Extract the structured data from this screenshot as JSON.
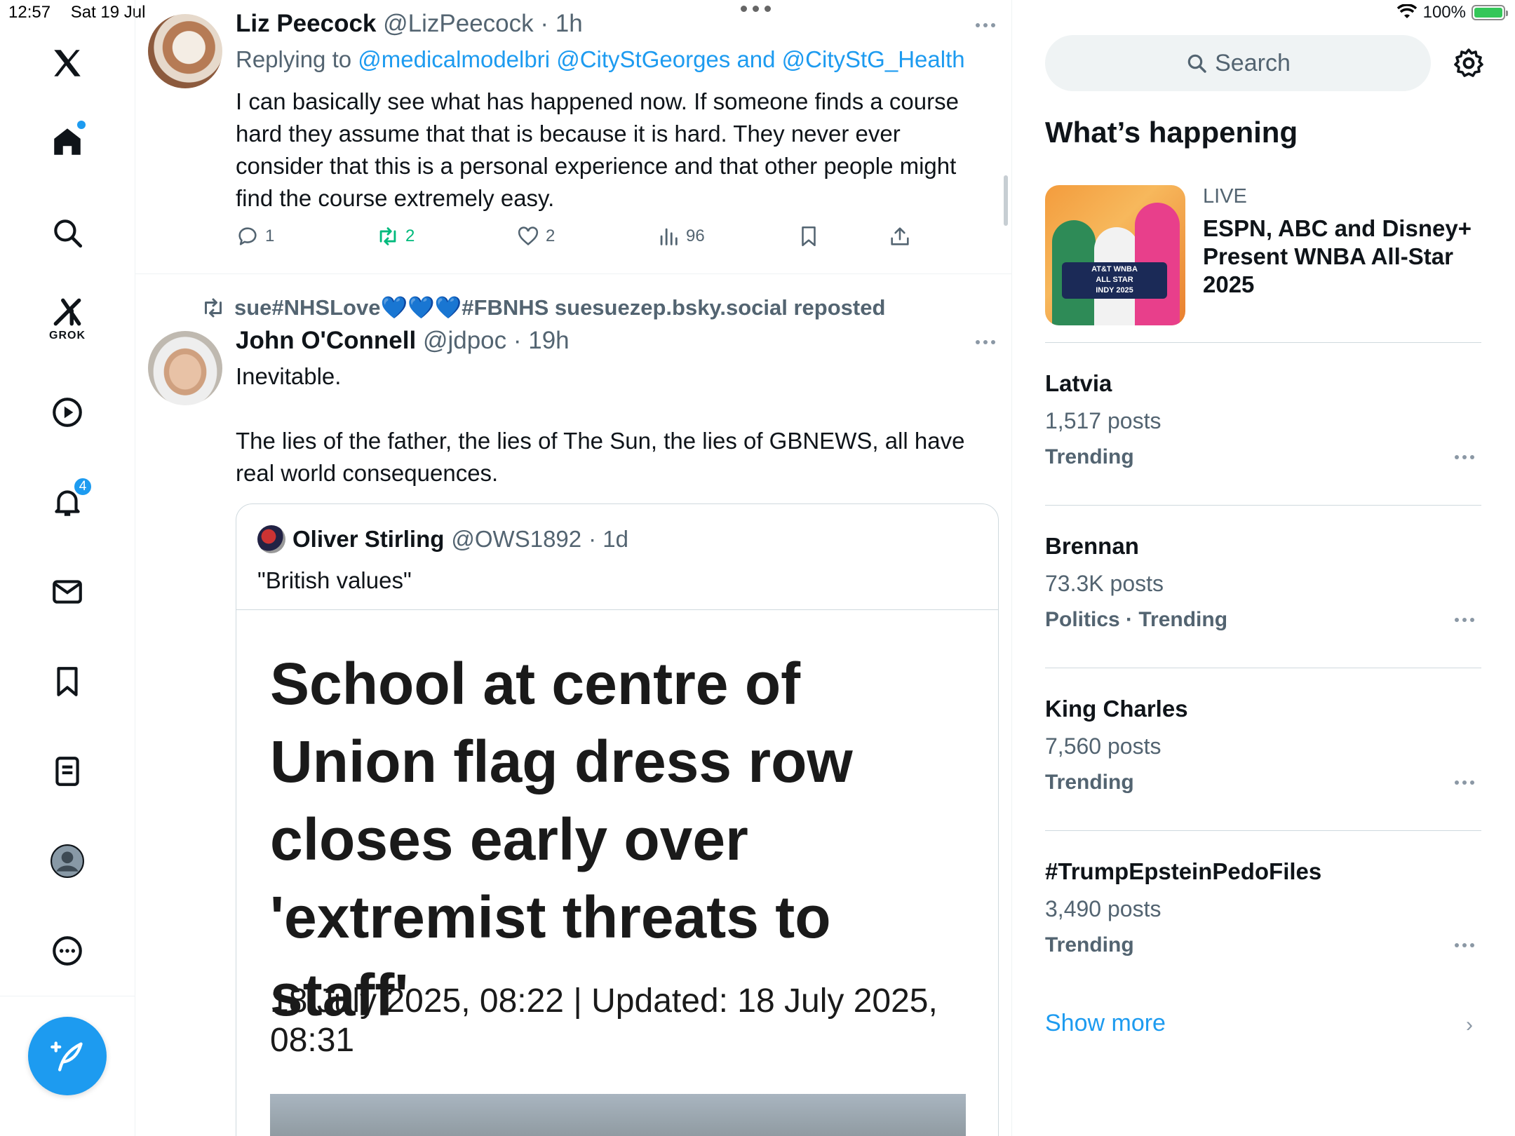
{
  "status_bar": {
    "time": "12:57",
    "date": "Sat 19 Jul",
    "battery": "100%"
  },
  "nav": {
    "notifications_badge": "4",
    "grok_label": "GROK"
  },
  "tweets": [
    {
      "name": "Liz Peecock",
      "handle": "@LizPeecock",
      "time": "· 1h",
      "replying_prefix": "Replying to ",
      "replying_mentions": "@medicalmodelbri @CityStGeorges and @CityStG_Health",
      "body": "I can basically see what has happened now.  If someone finds a course hard they assume that that is because it is hard.  They never ever consider that this is a personal experience and that other people might find the course extremely easy.",
      "replies": "1",
      "reposts": "2",
      "likes": "2",
      "views": "96"
    },
    {
      "repost_by": "sue#NHSLove",
      "repost_hearts": "💙💙💙",
      "repost_rest": "#FBNHS suesuezep.bsky.social reposted",
      "name": "John O'Connell",
      "handle": "@jdpoc",
      "time": "· 19h",
      "body_line1": "Inevitable.",
      "body_line2": "The lies of the father, the lies of The Sun, the lies of GBNEWS, all have real world consequences.",
      "quote": {
        "name": "Oliver Stirling",
        "handle": "@OWS1892",
        "time": "· 1d",
        "text": "\"British values\"",
        "headline": "School at centre of Union flag dress row closes early over 'extremist threats to staff'",
        "dateline": "18 July 2025, 08:22 | Updated: 18 July 2025, 08:31"
      }
    }
  ],
  "sidebar": {
    "search_placeholder": "Search",
    "section_title": "What’s happening",
    "featured": {
      "label": "LIVE",
      "title": "ESPN, ABC and Disney+ Present WNBA All-Star 2025",
      "image_text_1": "AT&T WNBA",
      "image_text_2": "ALL STAR",
      "image_text_3": "INDY 2025"
    },
    "trends": [
      {
        "name": "Latvia",
        "count": "1,517 posts",
        "category": "Trending"
      },
      {
        "name": "Brennan",
        "count": "73.3K posts",
        "category": "Politics · Trending"
      },
      {
        "name": "King Charles",
        "count": "7,560 posts",
        "category": "Trending"
      },
      {
        "name": "#TrumpEpsteinPedoFiles",
        "count": "3,490 posts",
        "category": "Trending"
      }
    ],
    "show_more": "Show more"
  },
  "colors": {
    "accent": "#1d9bf0",
    "repost_green": "#00ba7c",
    "muted": "#536471"
  }
}
